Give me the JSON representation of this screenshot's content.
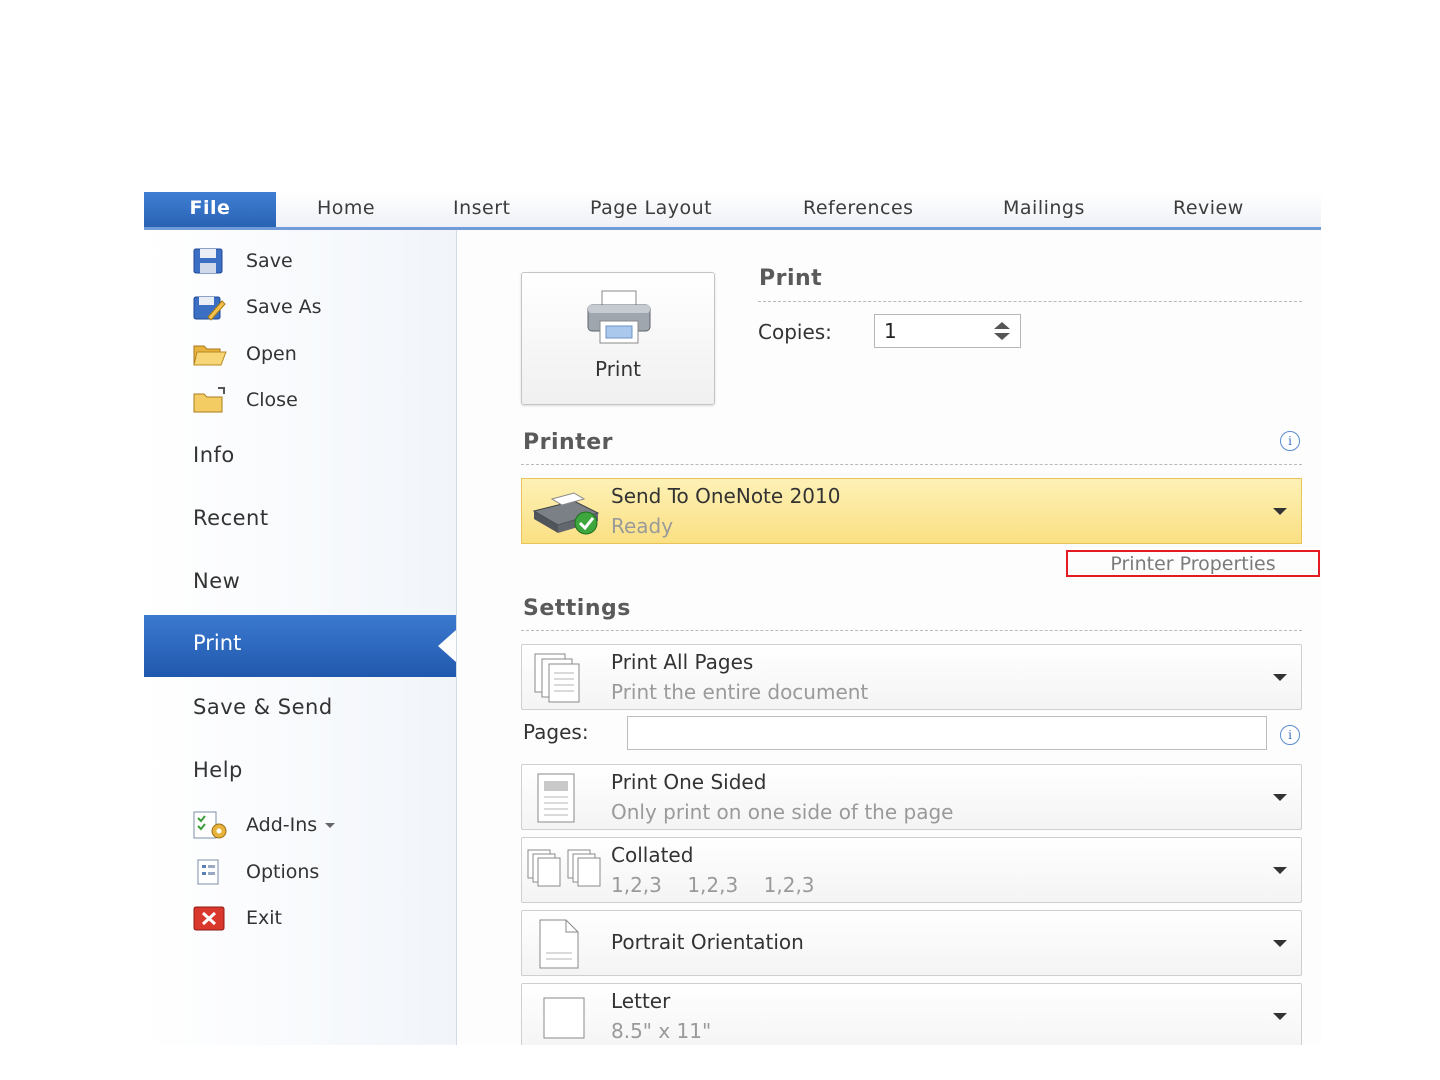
{
  "ribbon": {
    "tabs": [
      "File",
      "Home",
      "Insert",
      "Page Layout",
      "References",
      "Mailings",
      "Review"
    ]
  },
  "backstage": {
    "commands": [
      {
        "label": "Save",
        "icon": "save-icon"
      },
      {
        "label": "Save As",
        "icon": "save-as-icon"
      },
      {
        "label": "Open",
        "icon": "open-folder-icon"
      },
      {
        "label": "Close",
        "icon": "close-folder-icon"
      }
    ],
    "nav": [
      "Info",
      "Recent",
      "New",
      "Print",
      "Save & Send",
      "Help"
    ],
    "selected_nav": "Print",
    "tools": [
      {
        "label": "Add-Ins",
        "icon": "add-ins-icon"
      },
      {
        "label": "Options",
        "icon": "options-icon"
      },
      {
        "label": "Exit",
        "icon": "exit-icon"
      }
    ]
  },
  "print": {
    "button_label": "Print",
    "header": "Print",
    "copies_label": "Copies:",
    "copies_value": "1"
  },
  "printer": {
    "header": "Printer",
    "name": "Send To OneNote 2010",
    "status": "Ready",
    "properties_link": "Printer Properties"
  },
  "settings": {
    "header": "Settings",
    "range": {
      "main": "Print All Pages",
      "sub": "Print the entire document"
    },
    "pages_label": "Pages:",
    "pages_value": "",
    "sides": {
      "main": "Print One Sided",
      "sub": "Only print on one side of the page"
    },
    "collation": {
      "main": "Collated",
      "sub": "1,2,3    1,2,3    1,2,3"
    },
    "orientation": {
      "main": "Portrait Orientation"
    },
    "paper": {
      "main": "Letter",
      "sub": "8.5\" x 11\""
    }
  },
  "colors": {
    "file_tab": "#2a62b4",
    "selected_nav": "#2058ad",
    "printer_highlight": "#fbe083",
    "callout_border": "#e31b23"
  }
}
